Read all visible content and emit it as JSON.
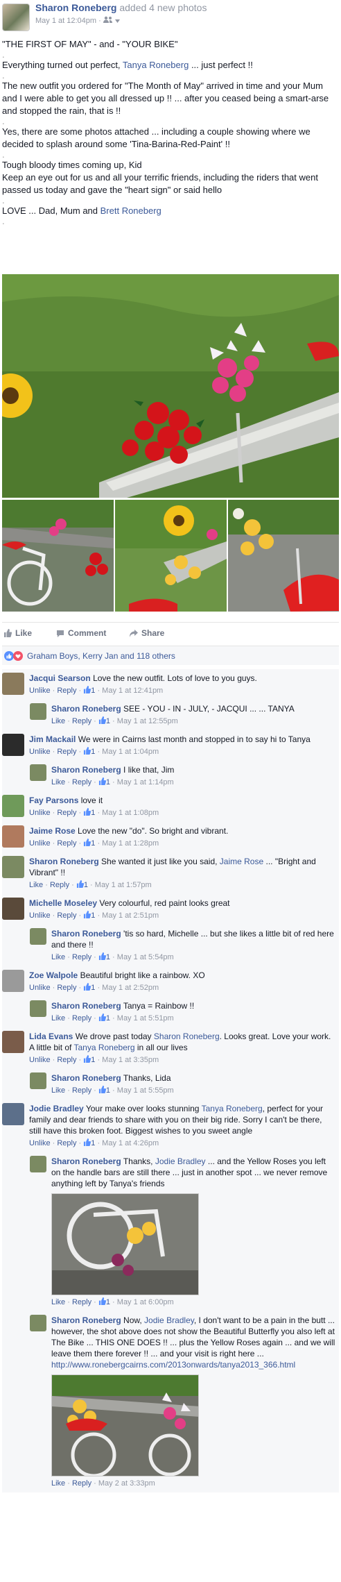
{
  "post": {
    "author": "Sharon Roneberg",
    "action": "added 4 new photos",
    "timestamp": "May 1 at 12:04pm",
    "dot": "·",
    "privacy_icon": "friends-icon",
    "paragraphs": [
      "\"THE FIRST OF MAY\" - and - \"YOUR BIKE\"",
      ".",
      "Everything turned out perfect, ",
      "The new outfit you ordered for \"The Month of May\" arrived in time and your Mum and I were able to get you all dressed up !! ... after you ceased being a smart-arse and stopped the rain, that is !!",
      ".",
      "Yes, there are some photos attached ... including a couple showing where we decided to splash around some 'Tina-Barina-Red-Paint' !!",
      ".",
      "Tough bloody times coming up, Kid",
      "Keep an eye out for us and all your terrific friends, including the riders that went passed us today and gave the \"heart sign\" or said hello",
      ".",
      "LOVE ... Dad, Mum and ",
      "."
    ],
    "tag_tanya": "Tanya Roneberg",
    "after_tanya": " ... just perfect !!",
    "tag_brett": "Brett Roneberg"
  },
  "actions": {
    "like": "Like",
    "comment": "Comment",
    "share": "Share"
  },
  "likes_summary": "Graham Boys, Kerry Jan and 118 others",
  "comments": [
    {
      "author": "Jacqui Searson",
      "text": "Love the new outfit. Lots of love to you guys. ",
      "unlike": "Unlike",
      "reply": "Reply",
      "count": "1",
      "time": "May 1 at 12:41pm",
      "avatar_color": "#8a7a5c",
      "reply_level": false
    },
    {
      "author": "Sharon Roneberg",
      "text": "SEE - YOU - IN - JULY, - JACQUI ... ... TANYA",
      "unlike": "Like",
      "reply": "Reply",
      "count": "1",
      "time": "May 1 at 12:55pm",
      "avatar_color": "#7b8a62",
      "reply_level": true
    },
    {
      "author": "Jim Mackail",
      "text": "We were in Cairns last month and stopped in to say hi to Tanya",
      "unlike": "Unlike",
      "reply": "Reply",
      "count": "1",
      "time": "May 1 at 1:04pm",
      "avatar_color": "#2b2b2b",
      "reply_level": false
    },
    {
      "author": "Sharon Roneberg",
      "text": "I like that, Jim",
      "unlike": "Like",
      "reply": "Reply",
      "count": "1",
      "time": "May 1 at 1:14pm",
      "avatar_color": "#7b8a62",
      "reply_level": true
    },
    {
      "author": "Fay Parsons",
      "text": "love it",
      "unlike": "Unlike",
      "reply": "Reply",
      "count": "1",
      "time": "May 1 at 1:08pm",
      "avatar_color": "#6f9a5a",
      "reply_level": false
    },
    {
      "author": "Jaime Rose",
      "text": "Love the new \"do\". So bright and vibrant.",
      "unlike": "Unlike",
      "reply": "Reply",
      "count": "1",
      "time": "May 1 at 1:28pm",
      "avatar_color": "#b07a5e",
      "reply_level": false
    },
    {
      "author": "Sharon Roneberg",
      "text": "She wanted it just like you said, ",
      "tag": "Jaime Rose",
      "text2": " ... \"Bright and Vibrant\" !!",
      "unlike": "Like",
      "reply": "Reply",
      "count": "1",
      "time": "May 1 at 1:57pm",
      "avatar_color": "#7b8a62",
      "reply_level": false
    },
    {
      "author": "Michelle Moseley",
      "text": "Very colourful, red paint looks great",
      "unlike": "Unlike",
      "reply": "Reply",
      "count": "1",
      "time": "May 1 at 2:51pm",
      "avatar_color": "#5a4a3a",
      "reply_level": false
    },
    {
      "author": "Sharon Roneberg",
      "text": "'tis so hard, Michelle ... but she likes a little bit of red here and there !!",
      "unlike": "Like",
      "reply": "Reply",
      "count": "1",
      "time": "May 1 at 5:54pm",
      "avatar_color": "#7b8a62",
      "reply_level": true
    },
    {
      "author": "Zoe Walpole",
      "text": "Beautiful bright like a rainbow. XO",
      "unlike": "Unlike",
      "reply": "Reply",
      "count": "1",
      "time": "May 1 at 2:52pm",
      "avatar_color": "#9a9a9a",
      "reply_level": false
    },
    {
      "author": "Sharon Roneberg",
      "text": "Tanya = Rainbow !!",
      "unlike": "Like",
      "reply": "Reply",
      "count": "1",
      "time": "May 1 at 5:51pm",
      "avatar_color": "#7b8a62",
      "reply_level": true
    },
    {
      "author": "Lida Evans",
      "text": "We drove past today ",
      "tag": "Sharon Roneberg",
      "text2": ". Looks great. Love your work. A little bit of ",
      "tag2": "Tanya Roneberg",
      "text3": " in all our lives",
      "unlike": "Unlike",
      "reply": "Reply",
      "count": "1",
      "time": "May 1 at 3:35pm",
      "avatar_color": "#7a5c4a",
      "reply_level": false
    },
    {
      "author": "Sharon Roneberg",
      "text": "Thanks, Lida",
      "unlike": "Like",
      "reply": "Reply",
      "count": "1",
      "time": "May 1 at 5:55pm",
      "avatar_color": "#7b8a62",
      "reply_level": true
    },
    {
      "author": "Jodie Bradley",
      "text": "Your make over looks stunning ",
      "tag": "Tanya Roneberg",
      "text2": ", perfect for your family and dear friends to share with you on their big ride. Sorry I can't be there, still have this broken foot. Biggest wishes to you sweet angle ",
      "unlike": "Unlike",
      "reply": "Reply",
      "count": "1",
      "time": "May 1 at 4:26pm",
      "avatar_color": "#5c6f8a",
      "reply_level": false
    },
    {
      "author": "Sharon Roneberg",
      "text": "Thanks, ",
      "tag": "Jodie Bradley",
      "text2": " ... and the Yellow Roses you left on the handle bars are still there ... just in another spot ... we never remove anything left by Tanya's friends",
      "unlike": "Like",
      "reply": "Reply",
      "count": "1",
      "time": "May 1 at 6:00pm",
      "avatar_color": "#7b8a62",
      "reply_level": true,
      "image": 1
    },
    {
      "author": "Sharon Roneberg",
      "text": "Now, ",
      "tag": "Jodie Bradley",
      "text2": ", I don't want to be a pain in the butt ... however, the shot above does not show the Beautiful Butterfly you also left at The Bike ... THIS ONE DOES !! ... plus the Yellow Roses again ... and we will leave them there forever !! ... and your visit is right here ...",
      "link": "http://www.ronebergcairns.com/2013onwards/tanya2013_366.html",
      "unlike": "Like",
      "reply": "Reply",
      "count": "",
      "time": "May 2 at 3:33pm",
      "avatar_color": "#7b8a62",
      "reply_level": true,
      "image": 2
    }
  ],
  "colors": {
    "brand": "#3b5998",
    "meta": "#9197a3",
    "comment_bg": "#f6f7f9"
  }
}
